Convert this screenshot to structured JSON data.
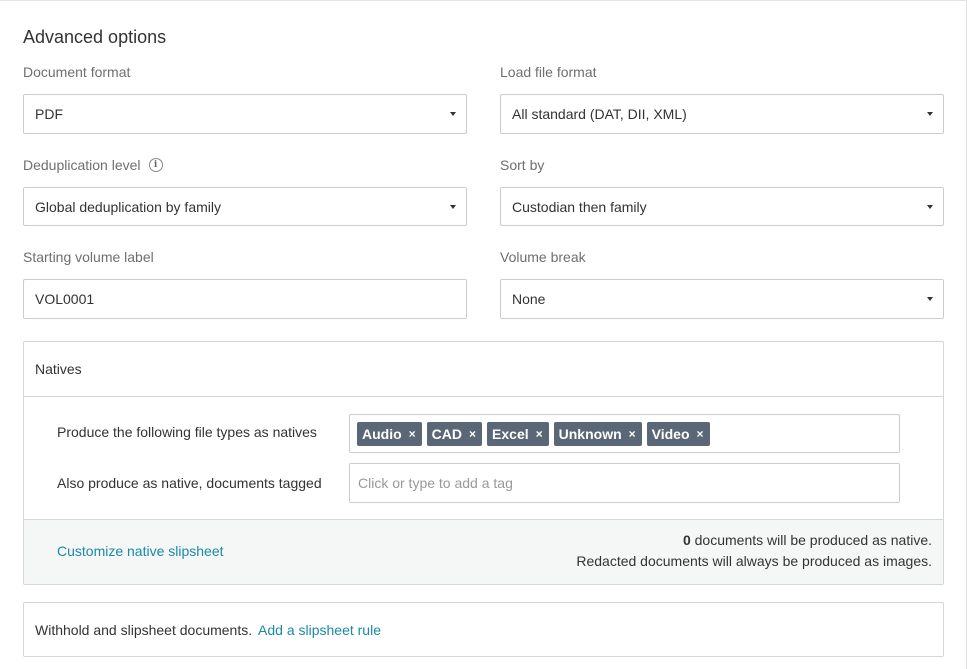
{
  "title": "Advanced options",
  "document_format": {
    "label": "Document format",
    "value": "PDF"
  },
  "load_file_format": {
    "label": "Load file format",
    "value": "All standard (DAT, DII, XML)"
  },
  "deduplication_level": {
    "label": "Deduplication level",
    "value": "Global deduplication by family",
    "info_icon": "info-icon"
  },
  "sort_by": {
    "label": "Sort by",
    "value": "Custodian then family"
  },
  "starting_volume_label": {
    "label": "Starting volume label",
    "value": "VOL0001"
  },
  "volume_break": {
    "label": "Volume break",
    "value": "None"
  },
  "natives": {
    "header": "Natives",
    "file_types_label": "Produce the following file types as natives",
    "tags": [
      "Audio",
      "CAD",
      "Excel",
      "Unknown",
      "Video"
    ],
    "tag_remove_glyph": "×",
    "tagged_label": "Also produce as native, documents tagged",
    "tagged_placeholder": "Click or type to add a tag",
    "customize_link": "Customize native slipsheet",
    "count": "0",
    "count_suffix": " documents will be produced as native.",
    "redacted_note": "Redacted documents will always be produced as images."
  },
  "withhold": {
    "text": "Withhold and slipsheet documents.",
    "link": "Add a slipsheet rule"
  },
  "colors": {
    "accent_link": "#1a8aa6",
    "tag_bg": "#5a6776",
    "footer_bg": "#f5f7f7"
  }
}
